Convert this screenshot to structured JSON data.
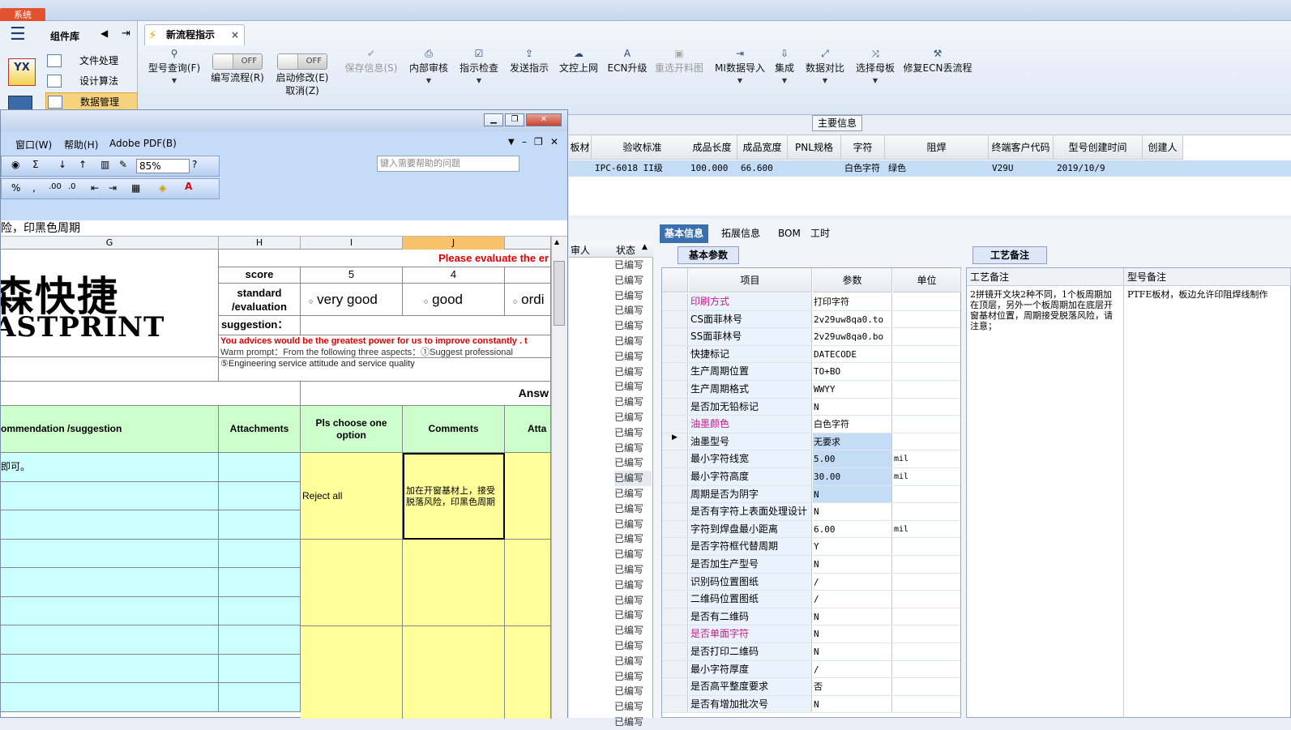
{
  "app": {
    "system_tab": "系统"
  },
  "leftnav": {
    "title": "组件库",
    "app_logo": "YX",
    "items": [
      "文件处理",
      "设计算法",
      "数据管理"
    ]
  },
  "doc_tab": {
    "label": "新流程指示",
    "close": "×"
  },
  "toolbar": [
    {
      "label": "型号查询(F)",
      "icon": "search-icon",
      "glyph": "⚲",
      "dropdown": true,
      "enabled": true
    },
    {
      "label": "编写流程(R)",
      "icon": "toggle",
      "toggle": "OFF",
      "enabled": true
    },
    {
      "label": "启动修改(E)",
      "sub": "取消(Z)",
      "icon": "toggle",
      "toggle": "OFF",
      "enabled": true
    },
    {
      "label": "保存信息(S)",
      "icon": "check-icon",
      "glyph": "✔",
      "enabled": false
    },
    {
      "label": "内部审核",
      "icon": "printer-icon",
      "glyph": "⎙",
      "dropdown": true,
      "enabled": true
    },
    {
      "label": "指示检查",
      "icon": "checkbox-icon",
      "glyph": "☑",
      "dropdown": true,
      "enabled": true
    },
    {
      "label": "发送指示",
      "icon": "upload-icon",
      "glyph": "⇪",
      "enabled": true
    },
    {
      "label": "文控上网",
      "icon": "cloud-upload-icon",
      "glyph": "☁",
      "enabled": true
    },
    {
      "label": "ECN升级",
      "icon": "font-a-icon",
      "glyph": "A",
      "enabled": true
    },
    {
      "label": "重选开料图",
      "icon": "image-icon",
      "glyph": "▣",
      "enabled": false
    },
    {
      "label": "MI数据导入",
      "icon": "import-icon",
      "glyph": "⇥",
      "dropdown": true,
      "enabled": true
    },
    {
      "label": "集成",
      "icon": "download-icon",
      "glyph": "⇩",
      "dropdown": true,
      "enabled": true
    },
    {
      "label": "数据对比",
      "icon": "compare-icon",
      "glyph": "⤢",
      "dropdown": true,
      "enabled": true
    },
    {
      "label": "选择母板",
      "icon": "shuffle-icon",
      "glyph": "⤨",
      "dropdown": true,
      "enabled": true
    },
    {
      "label": "修复ECN丢流程",
      "icon": "wrench-icon",
      "glyph": "⚒",
      "enabled": true
    }
  ],
  "main_info": {
    "title": "主要信息",
    "headers": [
      "板材",
      "验收标准",
      "成品长度",
      "成品宽度",
      "PNL规格",
      "字符",
      "阻焊",
      "终端客户代码",
      "型号创建时间",
      "创建人"
    ],
    "row": [
      "",
      "IPC-6018 II级",
      "100.000",
      "66.600",
      "",
      "白色字符",
      "绿色",
      "V29U",
      "2019/10/9",
      ""
    ]
  },
  "status_list": {
    "header_left": "审人",
    "header": "状态",
    "item": "已编写",
    "count": 31
  },
  "detail_tabs": [
    "基本信息",
    "拓展信息",
    "BOM",
    "工时"
  ],
  "basic_params": {
    "tab": "基本参数",
    "headers": [
      "项目",
      "参数",
      "单位"
    ],
    "rows": [
      {
        "name": "印刷方式",
        "value": "打印字符",
        "unit": "",
        "pink": true
      },
      {
        "name": "CS面菲林号",
        "value": "2v29uw8qa0.to",
        "unit": ""
      },
      {
        "name": "SS面菲林号",
        "value": "2v29uw8qa0.bo",
        "unit": ""
      },
      {
        "name": "快捷标记",
        "value": "DATECODE",
        "unit": ""
      },
      {
        "name": "生产周期位置",
        "value": "TO+BO",
        "unit": ""
      },
      {
        "name": "生产周期格式",
        "value": "WWYY",
        "unit": ""
      },
      {
        "name": "是否加无铅标记",
        "value": "N",
        "unit": ""
      },
      {
        "name": "油墨颜色",
        "value": "白色字符",
        "unit": "",
        "pink": true
      },
      {
        "name": "油墨型号",
        "value": "无要求",
        "unit": "",
        "hl": true,
        "current": true
      },
      {
        "name": "最小字符线宽",
        "value": "5.00",
        "unit": "mil",
        "hl": true
      },
      {
        "name": "最小字符高度",
        "value": "30.00",
        "unit": "mil",
        "hl": true
      },
      {
        "name": "周期是否为阴字",
        "value": "N",
        "unit": "",
        "hl": true
      },
      {
        "name": "是否有字符上表面处理设计",
        "value": "N",
        "unit": ""
      },
      {
        "name": "字符到焊盘最小距离",
        "value": "6.00",
        "unit": "mil"
      },
      {
        "name": "是否字符框代替周期",
        "value": "Y",
        "unit": ""
      },
      {
        "name": "是否加生产型号",
        "value": "N",
        "unit": ""
      },
      {
        "name": "识别码位置图纸",
        "value": "/",
        "unit": ""
      },
      {
        "name": "二维码位置图纸",
        "value": "/",
        "unit": ""
      },
      {
        "name": "是否有二维码",
        "value": "N",
        "unit": ""
      },
      {
        "name": "是否单面字符",
        "value": "N",
        "unit": "",
        "pink": true
      },
      {
        "name": "是否打印二维码",
        "value": "N",
        "unit": ""
      },
      {
        "name": "最小字符厚度",
        "value": "/",
        "unit": ""
      },
      {
        "name": "是否高平整度要求",
        "value": "否",
        "unit": ""
      },
      {
        "name": "是否有增加批次号",
        "value": "N",
        "unit": ""
      }
    ]
  },
  "notes": {
    "tab": "工艺备注",
    "col1_header": "工艺备注",
    "col2_header": "型号备注",
    "col1_text": "2拼镜开文块2种不同，1个板周期加在顶层，另外一个板周期加在底层开窗基材位置，周期接受脱落风险，请注意；",
    "col2_text": "PTFE板材，板边允许印阻焊线制作"
  },
  "excel": {
    "menu": [
      "窗口(W)",
      "帮助(H)",
      "Adobe PDF(B)"
    ],
    "help_placeholder": "键入需要帮助的问题",
    "zoom": "85%",
    "formula_text": "险，印黑色周期",
    "columns": [
      "G",
      "H",
      "I",
      "J"
    ],
    "logo_cn": "森快捷",
    "logo_en": "ASTPRINT",
    "score_label": "score",
    "score_5": "5",
    "score_4": "4",
    "standard_label": "standard /evaluation",
    "opt_very_good": "very good",
    "opt_good": "good",
    "opt_ordinary": "ordi",
    "suggestion_label": "suggestion：",
    "please_eval": "Please evaluate the er",
    "advice_red": "You advices would be the greatest power for us to improve constantly .   t",
    "warm_prompt": "Warm prompt：From the following three aspects：①Suggest professional",
    "service_line": "⑤Engineering service attitude and service quality",
    "answer": "Answ",
    "hdr_recommend": "ommendation /suggestion",
    "hdr_attachments": "Attachments",
    "hdr_choose": "Pls choose one option",
    "hdr_comments": "Comments",
    "hdr_atta": "Atta",
    "cell_ok": "即可。",
    "reject_all": "Reject all",
    "comment_text": "加在开窗基材上，接受脱落风险，印黑色周期"
  },
  "colors": {
    "accent": "#c4dcf5",
    "pink": "#c0208a",
    "green_cell": "#ccffcc",
    "cyan_cell": "#ccffff",
    "yellow_cell": "#ffff99",
    "red_text": "#e00000"
  }
}
